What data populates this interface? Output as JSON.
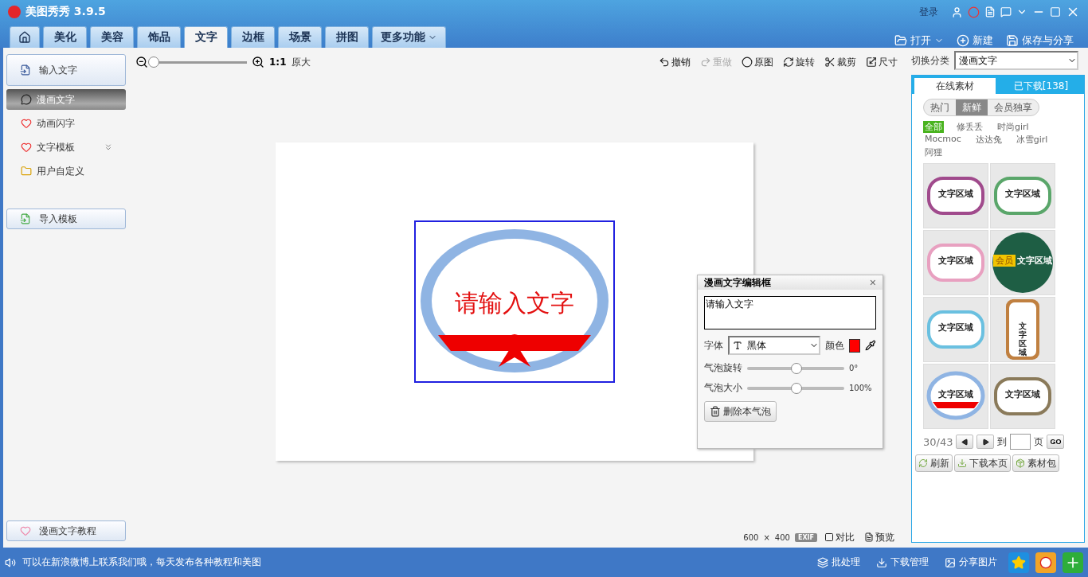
{
  "window": {
    "title": "美图秀秀 3.9.5",
    "links": [
      "登录"
    ]
  },
  "tabs": [
    {
      "kind": "home",
      "selected": false
    },
    {
      "kind": "text",
      "label": "美化",
      "selected": false
    },
    {
      "kind": "text",
      "label": "美容",
      "selected": false
    },
    {
      "kind": "text",
      "label": "饰品",
      "selected": false
    },
    {
      "kind": "text",
      "label": "文字",
      "selected": true
    },
    {
      "kind": "text",
      "label": "边框",
      "selected": false
    },
    {
      "kind": "text",
      "label": "场景",
      "selected": false
    },
    {
      "kind": "text",
      "label": "拼图",
      "selected": false
    },
    {
      "kind": "menu",
      "label": "更多功能",
      "selected": false
    }
  ],
  "file_actions": [
    {
      "kind": "open",
      "label": "打开"
    },
    {
      "kind": "new",
      "label": "新建"
    },
    {
      "kind": "save",
      "label": "保存与分享"
    }
  ],
  "sidebar": {
    "top_button": "输入文字",
    "items": [
      {
        "kind": "comic",
        "label": "漫画文字",
        "selected": true
      },
      {
        "kind": "flash",
        "label": "动画闪字",
        "selected": false
      },
      {
        "kind": "template",
        "label": "文字模板",
        "selected": false
      },
      {
        "kind": "custom",
        "label": "用户自定义",
        "selected": false
      }
    ],
    "import_button": "导入模板",
    "tutorial_button": "漫画文字教程"
  },
  "toolbar": {
    "zoom": {
      "level": 0
    },
    "ratio": "1:1",
    "original_size": "原大",
    "actions": [
      {
        "kind": "undo",
        "label": "撤销",
        "disabled": false
      },
      {
        "kind": "redo",
        "label": "重做",
        "disabled": true
      },
      {
        "kind": "original",
        "label": "原图",
        "disabled": false
      },
      {
        "kind": "rotate",
        "label": "旋转",
        "disabled": false
      },
      {
        "kind": "crop",
        "label": "裁剪",
        "disabled": false
      },
      {
        "kind": "size",
        "label": "尺寸",
        "disabled": false
      }
    ]
  },
  "canvas": {
    "bubble_text": "请输入文字"
  },
  "editor": {
    "title": "漫画文字编辑框",
    "close": "×",
    "text_value": "请输入文字",
    "font_label": "字体",
    "font_value": "黑体",
    "color_label": "颜色",
    "color": "#ff0000",
    "sliders": [
      {
        "label": "气泡旋转",
        "level": 0.5,
        "reading": "0°"
      },
      {
        "label": "气泡大小",
        "level": 0.5,
        "reading": "100%"
      }
    ],
    "delete_button": "删除本气泡"
  },
  "footer": {
    "size_w": "600",
    "size_x": "×",
    "size_h": "400",
    "exif": "EXIF",
    "compare": "对比",
    "preview": "预览"
  },
  "right_panel": {
    "category_label": "切换分类",
    "category_value": "漫画文字",
    "tabs": [
      {
        "label": "在线素材",
        "selected": true
      },
      {
        "label": "已下载[138]",
        "selected": false
      }
    ],
    "filters": [
      {
        "label": "热门",
        "selected": false
      },
      {
        "label": "新鲜",
        "selected": true
      },
      {
        "label": "会员独享",
        "selected": false
      }
    ],
    "authors": [
      {
        "label": "全部",
        "selected": true
      },
      {
        "label": "修丢丢",
        "selected": false
      },
      {
        "label": "时尚girl",
        "selected": false
      },
      {
        "label": "Mocmoc",
        "selected": false
      },
      {
        "label": "达达兔",
        "selected": false
      },
      {
        "label": "冰雪girl",
        "selected": false
      },
      {
        "label": "阿狸",
        "selected": false
      }
    ],
    "thumbnails": [
      {
        "kind": "cloud",
        "label": "文字区域",
        "color": "#a04a8c"
      },
      {
        "kind": "cloud",
        "label": "文字区域",
        "color": "#5aa66a"
      },
      {
        "kind": "cloud",
        "label": "文字区域",
        "color": "#e8a0c0"
      },
      {
        "kind": "member",
        "label": "文字区域",
        "badge": "会员",
        "color": "#1e5e44"
      },
      {
        "kind": "cloud",
        "label": "文字区域",
        "color": "#6ac0e0"
      },
      {
        "kind": "vertical",
        "label": "文字区域",
        "color": "#c08040"
      },
      {
        "kind": "ribbon",
        "label": "文字区域",
        "color": "#8fb4e3"
      },
      {
        "kind": "cloud",
        "label": "文字区域",
        "color": "#8a7a5a"
      }
    ],
    "page": "30/43",
    "goto_label": "到",
    "page_unit": "页",
    "go": "GO",
    "buttons": [
      {
        "kind": "refresh",
        "label": "刷新"
      },
      {
        "kind": "download",
        "label": "下载本页"
      },
      {
        "kind": "package",
        "label": "素材包"
      }
    ]
  },
  "status_bar": {
    "message": "可以在新浪微博上联系我们哦，每天发布各种教程和美图",
    "actions": [
      {
        "kind": "batch",
        "label": "批处理"
      },
      {
        "kind": "download",
        "label": "下载管理"
      },
      {
        "kind": "share",
        "label": "分享图片"
      }
    ]
  }
}
